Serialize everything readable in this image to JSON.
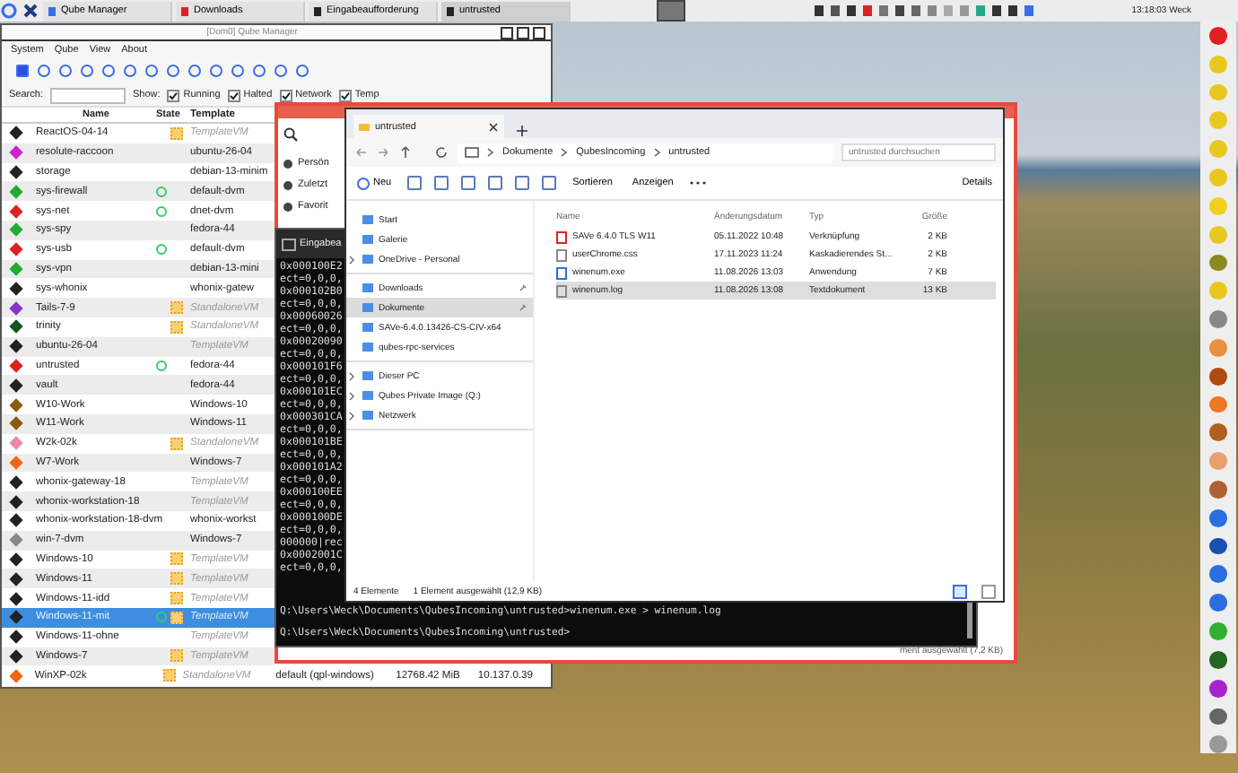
{
  "taskbar": {
    "tasks": [
      {
        "label": "Qube Manager",
        "selected": false,
        "color": "#3a6ee8"
      },
      {
        "label": "Downloads",
        "selected": false,
        "color": "#e02020"
      },
      {
        "label": "Eingabeaufforderung",
        "selected": false,
        "color": "#222222"
      },
      {
        "label": "untrusted",
        "selected": true,
        "color": "#222222"
      }
    ],
    "clock": "13:18:03 Weck"
  },
  "qube_manager": {
    "title": "[Dom0] Qube Manager",
    "menu": [
      "System",
      "Qube",
      "View",
      "About"
    ],
    "search_label": "Search:",
    "show_label": "Show:",
    "filters": [
      {
        "label": "Running",
        "checked": true
      },
      {
        "label": "Halted",
        "checked": true
      },
      {
        "label": "Network",
        "checked": true
      },
      {
        "label": "Temp",
        "checked": true
      }
    ],
    "columns": [
      "Name",
      "State",
      "Template"
    ],
    "rows": [
      {
        "name": "ReactOS-04-14",
        "running": false,
        "updates": true,
        "template": "TemplateVM",
        "kind": "template",
        "color": "#222222",
        "selected": false
      },
      {
        "name": "resolute-raccoon",
        "running": false,
        "updates": false,
        "template": "ubuntu-26-04",
        "kind": "app",
        "color": "#cc22cc",
        "selected": false
      },
      {
        "name": "storage",
        "running": false,
        "updates": false,
        "template": "debian-13-minim",
        "kind": "app",
        "color": "#222222",
        "selected": false
      },
      {
        "name": "sys-firewall",
        "running": true,
        "updates": false,
        "template": "default-dvm",
        "kind": "app",
        "color": "#22aa33",
        "selected": false
      },
      {
        "name": "sys-net",
        "running": true,
        "updates": false,
        "template": "dnet-dvm",
        "kind": "app",
        "color": "#dd2222",
        "selected": false
      },
      {
        "name": "sys-spy",
        "running": false,
        "updates": false,
        "template": "fedora-44",
        "kind": "app",
        "color": "#22aa33",
        "selected": false
      },
      {
        "name": "sys-usb",
        "running": true,
        "updates": false,
        "template": "default-dvm",
        "kind": "app",
        "color": "#dd2222",
        "selected": false
      },
      {
        "name": "sys-vpn",
        "running": false,
        "updates": false,
        "template": "debian-13-mini",
        "kind": "app",
        "color": "#22aa33",
        "selected": false
      },
      {
        "name": "sys-whonix",
        "running": false,
        "updates": false,
        "template": "whonix-gatew",
        "kind": "app",
        "color": "#222222",
        "selected": false
      },
      {
        "name": "Tails-7-9",
        "running": false,
        "updates": true,
        "template": "StandaloneVM",
        "kind": "standalone",
        "color": "#8833cc",
        "selected": false
      },
      {
        "name": "trinity",
        "running": false,
        "updates": true,
        "template": "StandaloneVM",
        "kind": "standalone",
        "color": "#115522",
        "selected": false
      },
      {
        "name": "ubuntu-26-04",
        "running": false,
        "updates": false,
        "template": "TemplateVM",
        "kind": "template",
        "color": "#222222",
        "selected": false
      },
      {
        "name": "untrusted",
        "running": true,
        "updates": false,
        "template": "fedora-44",
        "kind": "app",
        "color": "#dd2222",
        "selected": false
      },
      {
        "name": "vault",
        "running": false,
        "updates": false,
        "template": "fedora-44",
        "kind": "app",
        "color": "#222222",
        "selected": false
      },
      {
        "name": "W10-Work",
        "running": false,
        "updates": false,
        "template": "Windows-10",
        "kind": "app",
        "color": "#8a5a10",
        "selected": false
      },
      {
        "name": "W11-Work",
        "running": false,
        "updates": false,
        "template": "Windows-11",
        "kind": "app",
        "color": "#8a5a10",
        "selected": false
      },
      {
        "name": "W2k-02k",
        "running": false,
        "updates": true,
        "template": "StandaloneVM",
        "kind": "standalone",
        "color": "#ee88aa",
        "selected": false
      },
      {
        "name": "W7-Work",
        "running": false,
        "updates": false,
        "template": "Windows-7",
        "kind": "app",
        "color": "#ee6611",
        "selected": false
      },
      {
        "name": "whonix-gateway-18",
        "running": false,
        "updates": false,
        "template": "TemplateVM",
        "kind": "template",
        "color": "#222222",
        "selected": false
      },
      {
        "name": "whonix-workstation-18",
        "running": false,
        "updates": false,
        "template": "TemplateVM",
        "kind": "template",
        "color": "#222222",
        "selected": false
      },
      {
        "name": "whonix-workstation-18-dvm",
        "running": false,
        "updates": false,
        "template": "whonix-workst",
        "kind": "app",
        "color": "#222222",
        "selected": false
      },
      {
        "name": "win-7-dvm",
        "running": false,
        "updates": false,
        "template": "Windows-7",
        "kind": "app",
        "color": "#888888",
        "selected": false
      },
      {
        "name": "Windows-10",
        "running": false,
        "updates": true,
        "template": "TemplateVM",
        "kind": "template",
        "color": "#222222",
        "selected": false
      },
      {
        "name": "Windows-11",
        "running": false,
        "updates": true,
        "template": "TemplateVM",
        "kind": "template",
        "color": "#222222",
        "selected": false
      },
      {
        "name": "Windows-11-idd",
        "running": false,
        "updates": true,
        "template": "TemplateVM",
        "kind": "template",
        "color": "#222222",
        "selected": false
      },
      {
        "name": "Windows-11-mit",
        "running": true,
        "updates": true,
        "template": "TemplateVM",
        "kind": "template",
        "color": "#222222",
        "selected": true
      },
      {
        "name": "Windows-11-ohne",
        "running": false,
        "updates": false,
        "template": "TemplateVM",
        "kind": "template",
        "color": "#222222",
        "selected": false
      },
      {
        "name": "Windows-7",
        "running": false,
        "updates": true,
        "template": "TemplateVM",
        "kind": "template",
        "color": "#222222",
        "selected": false
      },
      {
        "name": "WinXP-02k",
        "running": false,
        "updates": true,
        "template": "StandaloneVM",
        "kind": "standalone",
        "color": "#ee6611",
        "selected": false,
        "column_4": "default (qpl-windows)",
        "column_5": "12768.42 MiB",
        "column_6": "10.137.0.39"
      }
    ]
  },
  "back_window": {
    "items": [
      "Persön",
      "Zuletzt",
      "Favorit"
    ],
    "status": "ment ausgewählt (7,2 KB)"
  },
  "terminal": {
    "title": "Eingabea",
    "lines": [
      "0x000100E2",
      "ect=0,0,0,",
      "0x000102B0",
      "ect=0,0,0,",
      "0x00060026",
      "ect=0,0,0,",
      "0x00020090",
      "ect=0,0,0,",
      "0x000101F6",
      "ect=0,0,0,",
      "0x000101EC",
      "ect=0,0,0,",
      "0x000301CA",
      "ect=0,0,0,",
      "0x000101BE",
      "ect=0,0,0,",
      "0x000101A2",
      "ect=0,0,0,",
      "0x000100EE",
      "ect=0,0,0,",
      "0x000100DE",
      "ect=0,0,0,",
      "000000|rec",
      "0x0002001C",
      "ect=0,0,0,"
    ],
    "commands": [
      "Q:\\Users\\Weck\\Documents\\QubesIncoming\\untrusted>winenum.exe > winenum.log",
      "Q:\\Users\\Weck\\Documents\\QubesIncoming\\untrusted>"
    ]
  },
  "explorer": {
    "tab": "untrusted",
    "breadcrumb": [
      "Dokumente",
      "QubesIncoming",
      "untrusted"
    ],
    "search": {
      "placeholder": "untrusted durchsuchen"
    },
    "toolbar": {
      "new": "Neu",
      "sort": "Sortieren",
      "view": "Anzeigen",
      "details": "Details"
    },
    "sidebar": [
      [
        {
          "label": "Start",
          "expandable": false,
          "pinned": false,
          "selected": false
        },
        {
          "label": "Galerie",
          "expandable": false,
          "pinned": false,
          "selected": false
        },
        {
          "label": "OneDrive - Personal",
          "expandable": true,
          "pinned": false,
          "selected": false
        }
      ],
      [
        {
          "label": "Downloads",
          "expandable": false,
          "pinned": true,
          "selected": false
        },
        {
          "label": "Dokumente",
          "expandable": false,
          "pinned": true,
          "selected": true
        },
        {
          "label": "SAVe-6.4.0.13426-CS-CIV-x64",
          "expandable": false,
          "pinned": false,
          "selected": false
        },
        {
          "label": "qubes-rpc-services",
          "expandable": false,
          "pinned": false,
          "selected": false
        }
      ],
      [
        {
          "label": "Dieser PC",
          "expandable": true,
          "pinned": false,
          "selected": false
        },
        {
          "label": "Qubes Private Image (Q:)",
          "expandable": true,
          "pinned": false,
          "selected": false
        },
        {
          "label": "Netzwerk",
          "expandable": true,
          "pinned": false,
          "selected": false
        }
      ]
    ],
    "columns": [
      "Name",
      "Änderungsdatum",
      "Typ",
      "Größe"
    ],
    "files": [
      {
        "name": "SAVe 6.4.0 TLS W11",
        "date": "05.11.2022 10:48",
        "type": "Verknüpfung",
        "size": "2 KB",
        "kind": "shortcut",
        "selected": false
      },
      {
        "name": "userChrome.css",
        "date": "17.11.2023 11:24",
        "type": "Kaskadierendes St...",
        "size": "2 KB",
        "kind": "text",
        "selected": false
      },
      {
        "name": "winenum.exe",
        "date": "11.08.2026 13:03",
        "type": "Anwendung",
        "size": "7 KB",
        "kind": "app",
        "selected": false
      },
      {
        "name": "winenum.log",
        "date": "11.08.2026 13:08",
        "type": "Textdokument",
        "size": "13 KB",
        "kind": "text",
        "selected": true
      }
    ],
    "status": [
      "4 Elemente",
      "1 Element ausgewählt (12,9 KB)"
    ]
  }
}
